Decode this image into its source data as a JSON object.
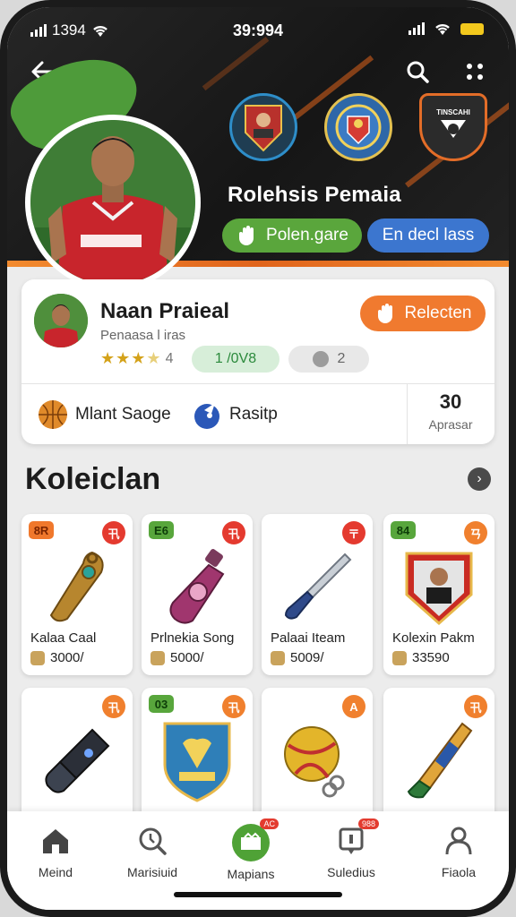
{
  "status_bar": {
    "carrier": "1394",
    "time": "39:994"
  },
  "hero": {
    "title": "Rolehsis Pemaia",
    "primary_pill": "Polen.gare",
    "secondary_pill": "En decl lass",
    "crest_3_text": "TINSCAHI"
  },
  "player": {
    "name": "Naan Praieal",
    "subtitle": "Penaasa l iras",
    "rating_value": "4",
    "rating_stars": 3.5,
    "chip_green": "1 /0V8",
    "chip_gray": "2",
    "action_button": "Relecten",
    "stat_1": "Mlant Saoge",
    "stat_2": "Rasitp",
    "count_value": "30",
    "count_label": "Aprasar"
  },
  "collection": {
    "title": "Koleiclan",
    "items": [
      {
        "tag": "8R",
        "name": "Kalaa Caal",
        "price": "3000/",
        "corner": "卂"
      },
      {
        "tag": "E6",
        "name": "Prlnekia Song",
        "price": "5000/",
        "corner": "卂"
      },
      {
        "tag": "",
        "name": "Palaai Iteam",
        "price": "5009/",
        "corner": "〒"
      },
      {
        "tag": "84",
        "name": "Kolexin Pakm",
        "price": "33590",
        "corner": "ㄢ"
      },
      {
        "tag": "",
        "name": "",
        "price": "",
        "corner": "卂"
      },
      {
        "tag": "03",
        "name": "",
        "price": "",
        "corner": "卂"
      },
      {
        "tag": "",
        "name": "",
        "price": "",
        "corner": "A"
      },
      {
        "tag": "",
        "name": "",
        "price": "",
        "corner": "卂"
      }
    ]
  },
  "nav": {
    "items": [
      {
        "label": "Meind"
      },
      {
        "label": "Marisiuid"
      },
      {
        "label": "Mapians",
        "badge": "AC"
      },
      {
        "label": "Suledius",
        "badge": "988"
      },
      {
        "label": "Fiaola"
      }
    ]
  },
  "colors": {
    "accent_orange": "#f07a2f",
    "accent_green": "#5aa63c",
    "accent_blue": "#3c76cf"
  }
}
